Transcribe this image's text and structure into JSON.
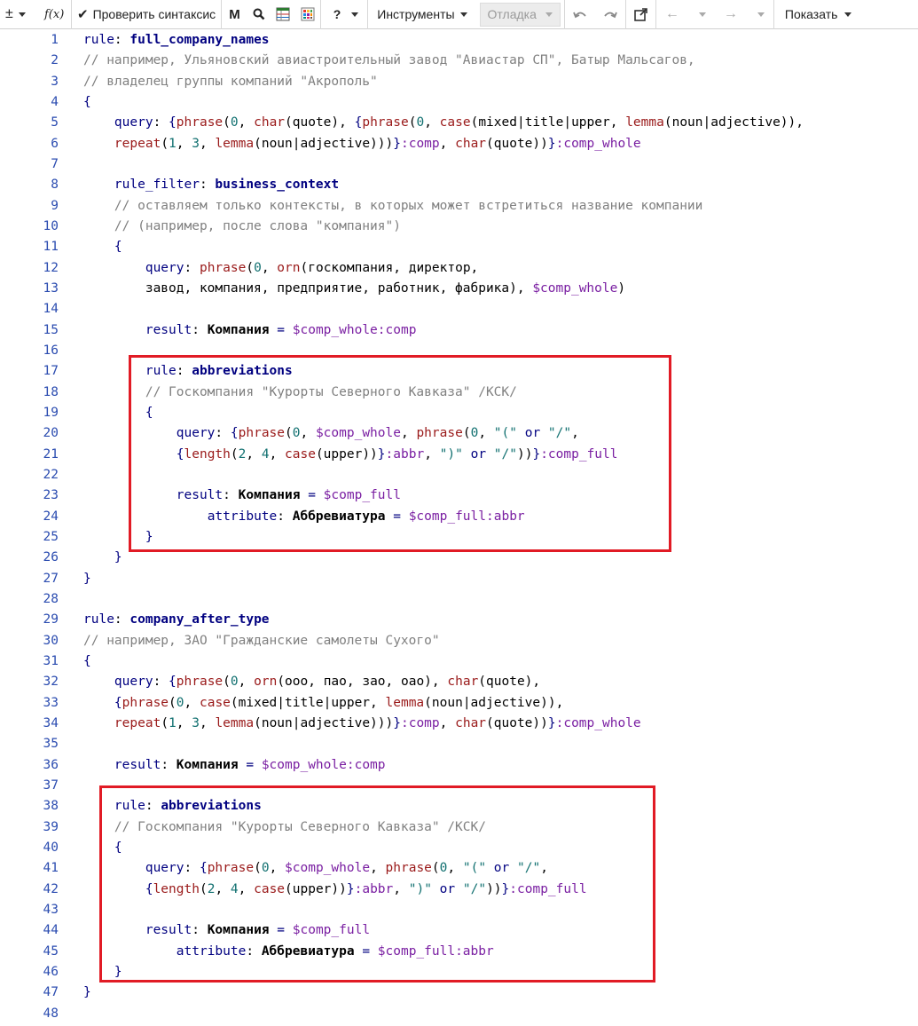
{
  "toolbar": {
    "diff_label": "±",
    "fx_label": "f(x)",
    "check_syntax": "Проверить синтаксис",
    "m_label": "M",
    "help_label": "?",
    "tools": "Инструменты",
    "debug": "Отладка",
    "show": "Показать"
  },
  "lines": [
    {
      "n": "1",
      "t": [
        [
          "kw",
          "rule"
        ],
        [
          "pl",
          ": "
        ],
        [
          "bn",
          "full_company_names"
        ]
      ]
    },
    {
      "n": "2",
      "t": [
        [
          "cm",
          "// например, Ульяновский авиастроительный завод \"Авиастар СП\", Батыр Мальсагов,"
        ]
      ]
    },
    {
      "n": "3",
      "t": [
        [
          "cm",
          "// владелец группы компаний \"Акрополь\""
        ]
      ]
    },
    {
      "n": "4",
      "t": [
        [
          "op",
          "{"
        ]
      ]
    },
    {
      "n": "5",
      "t": [
        [
          "pl",
          "    "
        ],
        [
          "kw",
          "query"
        ],
        [
          "pl",
          ": "
        ],
        [
          "op",
          "{"
        ],
        [
          "fn",
          "phrase"
        ],
        [
          "pl",
          "("
        ],
        [
          "num",
          "0"
        ],
        [
          "pl",
          ", "
        ],
        [
          "fn",
          "char"
        ],
        [
          "pl",
          "(quote), "
        ],
        [
          "op",
          "{"
        ],
        [
          "fn",
          "phrase"
        ],
        [
          "pl",
          "("
        ],
        [
          "num",
          "0"
        ],
        [
          "pl",
          ", "
        ],
        [
          "fn",
          "case"
        ],
        [
          "pl",
          "(mixed|title|upper, "
        ],
        [
          "fn",
          "lemma"
        ],
        [
          "pl",
          "(noun|adjective)),"
        ]
      ]
    },
    {
      "n": "6",
      "t": [
        [
          "pl",
          "    "
        ],
        [
          "fn",
          "repeat"
        ],
        [
          "pl",
          "("
        ],
        [
          "num",
          "1"
        ],
        [
          "pl",
          ", "
        ],
        [
          "num",
          "3"
        ],
        [
          "pl",
          ", "
        ],
        [
          "fn",
          "lemma"
        ],
        [
          "pl",
          "(noun|adjective)))"
        ],
        [
          "op",
          "}"
        ],
        [
          "var",
          ":comp"
        ],
        [
          "pl",
          ", "
        ],
        [
          "fn",
          "char"
        ],
        [
          "pl",
          "(quote))"
        ],
        [
          "op",
          "}"
        ],
        [
          "var",
          ":comp_whole"
        ]
      ]
    },
    {
      "n": "7",
      "t": []
    },
    {
      "n": "8",
      "t": [
        [
          "pl",
          "    "
        ],
        [
          "kw",
          "rule_filter"
        ],
        [
          "pl",
          ": "
        ],
        [
          "bn",
          "business_context"
        ]
      ]
    },
    {
      "n": "9",
      "t": [
        [
          "pl",
          "    "
        ],
        [
          "cm",
          "// оставляем только контексты, в которых может встретиться название компании"
        ]
      ]
    },
    {
      "n": "10",
      "t": [
        [
          "pl",
          "    "
        ],
        [
          "cm",
          "// (например, после слова \"компания\")"
        ]
      ]
    },
    {
      "n": "11",
      "t": [
        [
          "pl",
          "    "
        ],
        [
          "op",
          "{"
        ]
      ]
    },
    {
      "n": "12",
      "t": [
        [
          "pl",
          "        "
        ],
        [
          "kw",
          "query"
        ],
        [
          "pl",
          ": "
        ],
        [
          "fn",
          "phrase"
        ],
        [
          "pl",
          "("
        ],
        [
          "num",
          "0"
        ],
        [
          "pl",
          ", "
        ],
        [
          "fn",
          "orn"
        ],
        [
          "pl",
          "(госкомпания, директор,"
        ]
      ]
    },
    {
      "n": "13",
      "t": [
        [
          "pl",
          "        завод, компания, предприятие, работник, фабрика), "
        ],
        [
          "var",
          "$comp_whole"
        ],
        [
          "pl",
          ")"
        ]
      ]
    },
    {
      "n": "14",
      "t": []
    },
    {
      "n": "15",
      "t": [
        [
          "pl",
          "        "
        ],
        [
          "kw",
          "result"
        ],
        [
          "pl",
          ": "
        ],
        [
          "rs",
          "Компания"
        ],
        [
          "pl",
          " "
        ],
        [
          "op",
          "="
        ],
        [
          "pl",
          " "
        ],
        [
          "var",
          "$comp_whole:comp"
        ]
      ]
    },
    {
      "n": "16",
      "t": []
    },
    {
      "n": "17",
      "t": [
        [
          "pl",
          "        "
        ],
        [
          "kw",
          "rule"
        ],
        [
          "pl",
          ": "
        ],
        [
          "bn",
          "abbreviations"
        ]
      ]
    },
    {
      "n": "18",
      "t": [
        [
          "pl",
          "        "
        ],
        [
          "cm",
          "// Госкомпания \"Курорты Северного Кавказа\" /КСК/"
        ]
      ]
    },
    {
      "n": "19",
      "t": [
        [
          "pl",
          "        "
        ],
        [
          "op",
          "{"
        ]
      ]
    },
    {
      "n": "20",
      "t": [
        [
          "pl",
          "            "
        ],
        [
          "kw",
          "query"
        ],
        [
          "pl",
          ": "
        ],
        [
          "op",
          "{"
        ],
        [
          "fn",
          "phrase"
        ],
        [
          "pl",
          "("
        ],
        [
          "num",
          "0"
        ],
        [
          "pl",
          ", "
        ],
        [
          "var",
          "$comp_whole"
        ],
        [
          "pl",
          ", "
        ],
        [
          "fn",
          "phrase"
        ],
        [
          "pl",
          "("
        ],
        [
          "num",
          "0"
        ],
        [
          "pl",
          ", "
        ],
        [
          "str",
          "\"(\""
        ],
        [
          "pl",
          " "
        ],
        [
          "kw",
          "or"
        ],
        [
          "pl",
          " "
        ],
        [
          "str",
          "\"/\""
        ],
        [
          "pl",
          ","
        ]
      ]
    },
    {
      "n": "21",
      "t": [
        [
          "pl",
          "            "
        ],
        [
          "op",
          "{"
        ],
        [
          "fn",
          "length"
        ],
        [
          "pl",
          "("
        ],
        [
          "num",
          "2"
        ],
        [
          "pl",
          ", "
        ],
        [
          "num",
          "4"
        ],
        [
          "pl",
          ", "
        ],
        [
          "fn",
          "case"
        ],
        [
          "pl",
          "(upper))"
        ],
        [
          "op",
          "}"
        ],
        [
          "var",
          ":abbr"
        ],
        [
          "pl",
          ", "
        ],
        [
          "str",
          "\")\""
        ],
        [
          "pl",
          " "
        ],
        [
          "kw",
          "or"
        ],
        [
          "pl",
          " "
        ],
        [
          "str",
          "\"/\""
        ],
        [
          "pl",
          "))"
        ],
        [
          "op",
          "}"
        ],
        [
          "var",
          ":comp_full"
        ]
      ]
    },
    {
      "n": "22",
      "t": []
    },
    {
      "n": "23",
      "t": [
        [
          "pl",
          "            "
        ],
        [
          "kw",
          "result"
        ],
        [
          "pl",
          ": "
        ],
        [
          "rs",
          "Компания"
        ],
        [
          "pl",
          " "
        ],
        [
          "op",
          "="
        ],
        [
          "pl",
          " "
        ],
        [
          "var",
          "$comp_full"
        ]
      ]
    },
    {
      "n": "24",
      "t": [
        [
          "pl",
          "                "
        ],
        [
          "kw",
          "attribute"
        ],
        [
          "pl",
          ": "
        ],
        [
          "rs",
          "Аббревиатура"
        ],
        [
          "pl",
          " "
        ],
        [
          "op",
          "="
        ],
        [
          "pl",
          " "
        ],
        [
          "var",
          "$comp_full:abbr"
        ]
      ]
    },
    {
      "n": "25",
      "t": [
        [
          "pl",
          "        "
        ],
        [
          "op",
          "}"
        ]
      ]
    },
    {
      "n": "26",
      "t": [
        [
          "pl",
          "    "
        ],
        [
          "op",
          "}"
        ]
      ]
    },
    {
      "n": "27",
      "t": [
        [
          "op",
          "}"
        ]
      ]
    },
    {
      "n": "28",
      "t": []
    },
    {
      "n": "29",
      "t": [
        [
          "kw",
          "rule"
        ],
        [
          "pl",
          ": "
        ],
        [
          "bn",
          "company_after_type"
        ]
      ]
    },
    {
      "n": "30",
      "t": [
        [
          "cm",
          "// например, ЗАО \"Гражданские самолеты Сухого\""
        ]
      ]
    },
    {
      "n": "31",
      "t": [
        [
          "op",
          "{"
        ]
      ]
    },
    {
      "n": "32",
      "t": [
        [
          "pl",
          "    "
        ],
        [
          "kw",
          "query"
        ],
        [
          "pl",
          ": "
        ],
        [
          "op",
          "{"
        ],
        [
          "fn",
          "phrase"
        ],
        [
          "pl",
          "("
        ],
        [
          "num",
          "0"
        ],
        [
          "pl",
          ", "
        ],
        [
          "fn",
          "orn"
        ],
        [
          "pl",
          "(ооо, пао, зао, оао), "
        ],
        [
          "fn",
          "char"
        ],
        [
          "pl",
          "(quote),"
        ]
      ]
    },
    {
      "n": "33",
      "t": [
        [
          "pl",
          "    "
        ],
        [
          "op",
          "{"
        ],
        [
          "fn",
          "phrase"
        ],
        [
          "pl",
          "("
        ],
        [
          "num",
          "0"
        ],
        [
          "pl",
          ", "
        ],
        [
          "fn",
          "case"
        ],
        [
          "pl",
          "(mixed|title|upper, "
        ],
        [
          "fn",
          "lemma"
        ],
        [
          "pl",
          "(noun|adjective)),"
        ]
      ]
    },
    {
      "n": "34",
      "t": [
        [
          "pl",
          "    "
        ],
        [
          "fn",
          "repeat"
        ],
        [
          "pl",
          "("
        ],
        [
          "num",
          "1"
        ],
        [
          "pl",
          ", "
        ],
        [
          "num",
          "3"
        ],
        [
          "pl",
          ", "
        ],
        [
          "fn",
          "lemma"
        ],
        [
          "pl",
          "(noun|adjective)))"
        ],
        [
          "op",
          "}"
        ],
        [
          "var",
          ":comp"
        ],
        [
          "pl",
          ", "
        ],
        [
          "fn",
          "char"
        ],
        [
          "pl",
          "(quote))"
        ],
        [
          "op",
          "}"
        ],
        [
          "var",
          ":comp_whole"
        ]
      ]
    },
    {
      "n": "35",
      "t": []
    },
    {
      "n": "36",
      "t": [
        [
          "pl",
          "    "
        ],
        [
          "kw",
          "result"
        ],
        [
          "pl",
          ": "
        ],
        [
          "rs",
          "Компания"
        ],
        [
          "pl",
          " "
        ],
        [
          "op",
          "="
        ],
        [
          "pl",
          " "
        ],
        [
          "var",
          "$comp_whole:comp"
        ]
      ]
    },
    {
      "n": "37",
      "t": []
    },
    {
      "n": "38",
      "t": [
        [
          "pl",
          "    "
        ],
        [
          "kw",
          "rule"
        ],
        [
          "pl",
          ": "
        ],
        [
          "bn",
          "abbreviations"
        ]
      ]
    },
    {
      "n": "39",
      "t": [
        [
          "pl",
          "    "
        ],
        [
          "cm",
          "// Госкомпания \"Курорты Северного Кавказа\" /КСК/"
        ]
      ]
    },
    {
      "n": "40",
      "t": [
        [
          "pl",
          "    "
        ],
        [
          "op",
          "{"
        ]
      ]
    },
    {
      "n": "41",
      "t": [
        [
          "pl",
          "        "
        ],
        [
          "kw",
          "query"
        ],
        [
          "pl",
          ": "
        ],
        [
          "op",
          "{"
        ],
        [
          "fn",
          "phrase"
        ],
        [
          "pl",
          "("
        ],
        [
          "num",
          "0"
        ],
        [
          "pl",
          ", "
        ],
        [
          "var",
          "$comp_whole"
        ],
        [
          "pl",
          ", "
        ],
        [
          "fn",
          "phrase"
        ],
        [
          "pl",
          "("
        ],
        [
          "num",
          "0"
        ],
        [
          "pl",
          ", "
        ],
        [
          "str",
          "\"(\""
        ],
        [
          "pl",
          " "
        ],
        [
          "kw",
          "or"
        ],
        [
          "pl",
          " "
        ],
        [
          "str",
          "\"/\""
        ],
        [
          "pl",
          ","
        ]
      ]
    },
    {
      "n": "42",
      "t": [
        [
          "pl",
          "        "
        ],
        [
          "op",
          "{"
        ],
        [
          "fn",
          "length"
        ],
        [
          "pl",
          "("
        ],
        [
          "num",
          "2"
        ],
        [
          "pl",
          ", "
        ],
        [
          "num",
          "4"
        ],
        [
          "pl",
          ", "
        ],
        [
          "fn",
          "case"
        ],
        [
          "pl",
          "(upper))"
        ],
        [
          "op",
          "}"
        ],
        [
          "var",
          ":abbr"
        ],
        [
          "pl",
          ", "
        ],
        [
          "str",
          "\")\""
        ],
        [
          "pl",
          " "
        ],
        [
          "kw",
          "or"
        ],
        [
          "pl",
          " "
        ],
        [
          "str",
          "\"/\""
        ],
        [
          "pl",
          "))"
        ],
        [
          "op",
          "}"
        ],
        [
          "var",
          ":comp_full"
        ]
      ]
    },
    {
      "n": "43",
      "t": []
    },
    {
      "n": "44",
      "t": [
        [
          "pl",
          "        "
        ],
        [
          "kw",
          "result"
        ],
        [
          "pl",
          ": "
        ],
        [
          "rs",
          "Компания"
        ],
        [
          "pl",
          " "
        ],
        [
          "op",
          "="
        ],
        [
          "pl",
          " "
        ],
        [
          "var",
          "$comp_full"
        ]
      ]
    },
    {
      "n": "45",
      "t": [
        [
          "pl",
          "            "
        ],
        [
          "kw",
          "attribute"
        ],
        [
          "pl",
          ": "
        ],
        [
          "rs",
          "Аббревиатура"
        ],
        [
          "pl",
          " "
        ],
        [
          "op",
          "="
        ],
        [
          "pl",
          " "
        ],
        [
          "var",
          "$comp_full:abbr"
        ]
      ]
    },
    {
      "n": "46",
      "t": [
        [
          "pl",
          "    "
        ],
        [
          "op",
          "}"
        ]
      ]
    },
    {
      "n": "47",
      "t": [
        [
          "op",
          "}"
        ]
      ]
    },
    {
      "n": "48",
      "t": []
    }
  ]
}
